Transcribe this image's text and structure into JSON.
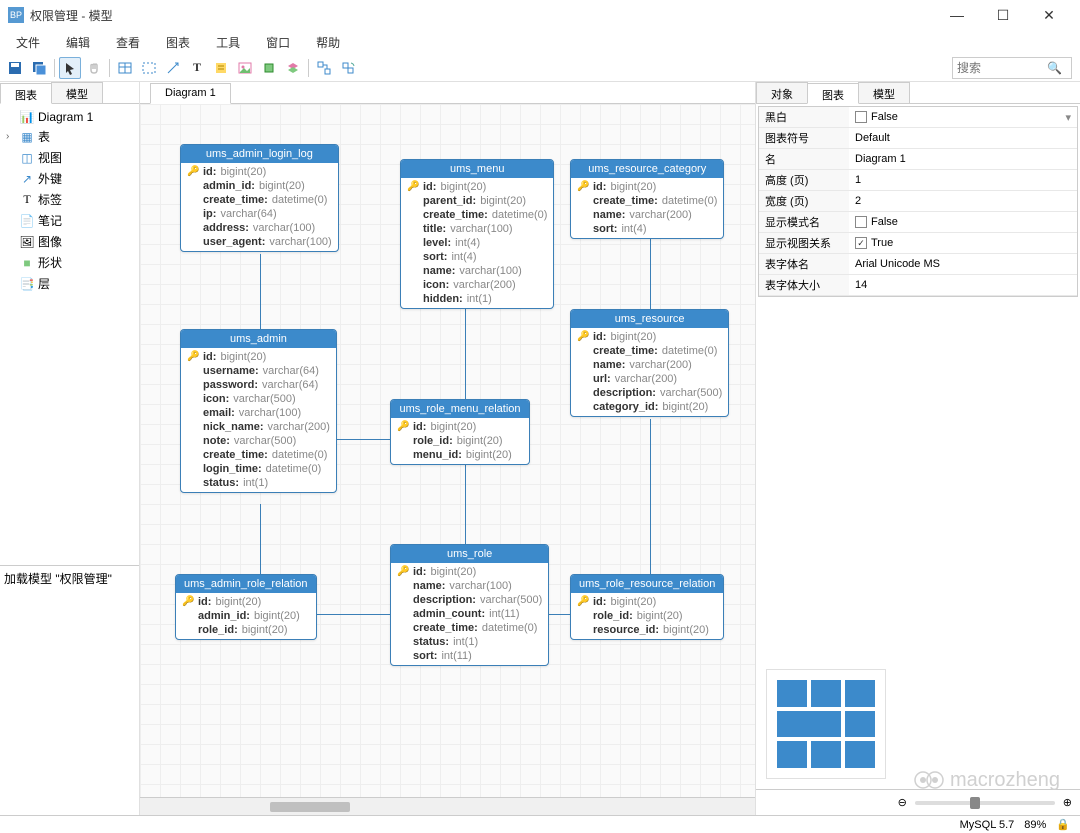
{
  "title": "权限管理 - 模型",
  "menus": [
    "文件",
    "编辑",
    "查看",
    "图表",
    "工具",
    "窗口",
    "帮助"
  ],
  "search_placeholder": "搜索",
  "left_tabs": {
    "a": "图表",
    "b": "模型"
  },
  "canvas_tab": "Diagram 1",
  "tree": {
    "diagram": "Diagram 1",
    "table": "表",
    "view": "视图",
    "fk": "外键",
    "label": "标签",
    "note": "笔记",
    "image": "图像",
    "shape": "形状",
    "layer": "层"
  },
  "status_text": "加载模型 \"权限管理\"",
  "right_tabs": {
    "a": "对象",
    "b": "图表",
    "c": "模型"
  },
  "props": {
    "bw_k": "黑白",
    "bw_v": "False",
    "sym_k": "图表符号",
    "sym_v": "Default",
    "name_k": "名",
    "name_v": "Diagram 1",
    "h_k": "高度 (页)",
    "h_v": "1",
    "w_k": "宽度 (页)",
    "w_v": "2",
    "mode_k": "显示模式名",
    "mode_v": "False",
    "rel_k": "显示视图关系",
    "rel_v": "True",
    "font_k": "表字体名",
    "font_v": "Arial Unicode MS",
    "fs_k": "表字体大小",
    "fs_v": "14"
  },
  "watermark": "macrozheng",
  "zoom_pct": "89%",
  "db": "MySQL 5.7",
  "entities": {
    "login_log": {
      "title": "ums_admin_login_log",
      "cols": [
        [
          "id",
          "bigint(20)",
          true
        ],
        [
          "admin_id",
          "bigint(20)",
          false
        ],
        [
          "create_time",
          "datetime(0)",
          false
        ],
        [
          "ip",
          "varchar(64)",
          false
        ],
        [
          "address",
          "varchar(100)",
          false
        ],
        [
          "user_agent",
          "varchar(100)",
          false
        ]
      ]
    },
    "menu": {
      "title": "ums_menu",
      "cols": [
        [
          "id",
          "bigint(20)",
          true
        ],
        [
          "parent_id",
          "bigint(20)",
          false
        ],
        [
          "create_time",
          "datetime(0)",
          false
        ],
        [
          "title",
          "varchar(100)",
          false
        ],
        [
          "level",
          "int(4)",
          false
        ],
        [
          "sort",
          "int(4)",
          false
        ],
        [
          "name",
          "varchar(100)",
          false
        ],
        [
          "icon",
          "varchar(200)",
          false
        ],
        [
          "hidden",
          "int(1)",
          false
        ]
      ]
    },
    "res_cat": {
      "title": "ums_resource_category",
      "cols": [
        [
          "id",
          "bigint(20)",
          true
        ],
        [
          "create_time",
          "datetime(0)",
          false
        ],
        [
          "name",
          "varchar(200)",
          false
        ],
        [
          "sort",
          "int(4)",
          false
        ]
      ]
    },
    "admin": {
      "title": "ums_admin",
      "cols": [
        [
          "id",
          "bigint(20)",
          true
        ],
        [
          "username",
          "varchar(64)",
          false
        ],
        [
          "password",
          "varchar(64)",
          false
        ],
        [
          "icon",
          "varchar(500)",
          false
        ],
        [
          "email",
          "varchar(100)",
          false
        ],
        [
          "nick_name",
          "varchar(200)",
          false
        ],
        [
          "note",
          "varchar(500)",
          false
        ],
        [
          "create_time",
          "datetime(0)",
          false
        ],
        [
          "login_time",
          "datetime(0)",
          false
        ],
        [
          "status",
          "int(1)",
          false
        ]
      ]
    },
    "resource": {
      "title": "ums_resource",
      "cols": [
        [
          "id",
          "bigint(20)",
          true
        ],
        [
          "create_time",
          "datetime(0)",
          false
        ],
        [
          "name",
          "varchar(200)",
          false
        ],
        [
          "url",
          "varchar(200)",
          false
        ],
        [
          "description",
          "varchar(500)",
          false
        ],
        [
          "category_id",
          "bigint(20)",
          false
        ]
      ]
    },
    "role_menu": {
      "title": "ums_role_menu_relation",
      "cols": [
        [
          "id",
          "bigint(20)",
          true
        ],
        [
          "role_id",
          "bigint(20)",
          false
        ],
        [
          "menu_id",
          "bigint(20)",
          false
        ]
      ]
    },
    "role": {
      "title": "ums_role",
      "cols": [
        [
          "id",
          "bigint(20)",
          true
        ],
        [
          "name",
          "varchar(100)",
          false
        ],
        [
          "description",
          "varchar(500)",
          false
        ],
        [
          "admin_count",
          "int(11)",
          false
        ],
        [
          "create_time",
          "datetime(0)",
          false
        ],
        [
          "status",
          "int(1)",
          false
        ],
        [
          "sort",
          "int(11)",
          false
        ]
      ]
    },
    "admin_role": {
      "title": "ums_admin_role_relation",
      "cols": [
        [
          "id",
          "bigint(20)",
          true
        ],
        [
          "admin_id",
          "bigint(20)",
          false
        ],
        [
          "role_id",
          "bigint(20)",
          false
        ]
      ]
    },
    "role_res": {
      "title": "ums_role_resource_relation",
      "cols": [
        [
          "id",
          "bigint(20)",
          true
        ],
        [
          "role_id",
          "bigint(20)",
          false
        ],
        [
          "resource_id",
          "bigint(20)",
          false
        ]
      ]
    }
  }
}
